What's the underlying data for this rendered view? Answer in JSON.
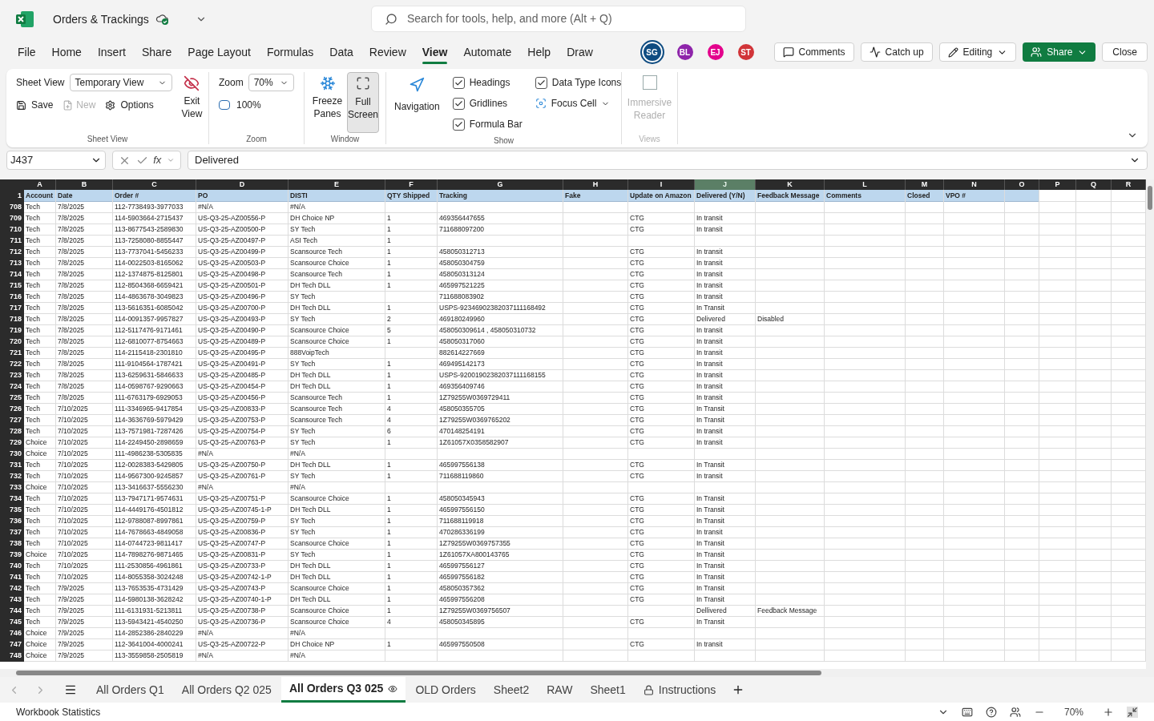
{
  "title_bar": {
    "file_name": "Orders & Trackings",
    "search_placeholder": "Search for tools, help, and more (Alt + Q)"
  },
  "menu_tabs": [
    {
      "label": "File",
      "selected": false
    },
    {
      "label": "Home",
      "selected": false
    },
    {
      "label": "Insert",
      "selected": false
    },
    {
      "label": "Share",
      "selected": false
    },
    {
      "label": "Page Layout",
      "selected": false
    },
    {
      "label": "Formulas",
      "selected": false
    },
    {
      "label": "Data",
      "selected": false
    },
    {
      "label": "Review",
      "selected": false
    },
    {
      "label": "View",
      "selected": true
    },
    {
      "label": "Automate",
      "selected": false
    },
    {
      "label": "Help",
      "selected": false
    },
    {
      "label": "Draw",
      "selected": false
    }
  ],
  "collaborators": [
    {
      "initials": "SG",
      "color": "#0f4c81"
    },
    {
      "initials": "BL",
      "color": "#8e24aa"
    },
    {
      "initials": "EJ",
      "color": "#e3008c"
    },
    {
      "initials": "ST",
      "color": "#d13438"
    }
  ],
  "header_buttons": {
    "comments": "Comments",
    "catch_up": "Catch up",
    "editing": "Editing",
    "share": "Share",
    "close": "Close"
  },
  "ribbon": {
    "sheet_view": {
      "label": "Sheet View",
      "dropdown": "Temporary View",
      "save": "Save",
      "new": "New",
      "new_disabled": true,
      "options": "Options",
      "exit": "Exit View",
      "group": "Sheet View"
    },
    "zoom": {
      "label": "Zoom",
      "value": "70%",
      "reset": "100%",
      "group": "Zoom"
    },
    "window": {
      "freeze": "Freeze Panes",
      "full_screen": "Full Screen",
      "full_screen_selected": true,
      "group": "Window"
    },
    "show": {
      "navigation": "Navigation",
      "checkboxes": [
        {
          "label": "Headings",
          "checked": true
        },
        {
          "label": "Gridlines",
          "checked": true
        },
        {
          "label": "Formula Bar",
          "checked": true
        },
        {
          "label": "Data Type Icons",
          "checked": true
        }
      ],
      "focus_cell": "Focus Cell",
      "group": "Show"
    },
    "views": {
      "reader": "Immersive Reader",
      "disabled": true,
      "group": "Views"
    }
  },
  "formula_bar": {
    "name_box": "J437",
    "fx": "fx",
    "value": "Delivered"
  },
  "columns": [
    {
      "letter": "A",
      "selected": false
    },
    {
      "letter": "B",
      "selected": false
    },
    {
      "letter": "C",
      "selected": false
    },
    {
      "letter": "D",
      "selected": false
    },
    {
      "letter": "E",
      "selected": false
    },
    {
      "letter": "F",
      "selected": false
    },
    {
      "letter": "G",
      "selected": false
    },
    {
      "letter": "H",
      "selected": false
    },
    {
      "letter": "I",
      "selected": false
    },
    {
      "letter": "J",
      "selected": true
    },
    {
      "letter": "K",
      "selected": false
    },
    {
      "letter": "L",
      "selected": false
    },
    {
      "letter": "M",
      "selected": false
    },
    {
      "letter": "N",
      "selected": false
    },
    {
      "letter": "O",
      "selected": false
    },
    {
      "letter": "P",
      "selected": false
    },
    {
      "letter": "Q",
      "selected": false
    },
    {
      "letter": "R",
      "selected": false
    }
  ],
  "header_row": {
    "row": "1",
    "A": "Account",
    "B": "Date",
    "C": "Order #",
    "D": "PO",
    "E": "DISTI",
    "F": "QTY Shipped",
    "G": "Tracking",
    "H": "Fake",
    "I": "Update on Amazon",
    "J": "Delivered (Y/N)",
    "K": "Feedback Message",
    "L": "Comments",
    "M": "Closed",
    "N": "VPO #"
  },
  "rows": [
    {
      "row": "708",
      "A": "Tech",
      "B": "7/8/2025",
      "C": "112-7738493-3977033",
      "D": "#N/A",
      "E": "#N/A"
    },
    {
      "row": "709",
      "A": "Tech",
      "B": "7/8/2025",
      "C": "114-5903664-2715437",
      "D": "US-Q3-25-AZ00556-P",
      "E": "DH Choice NP",
      "F": "1",
      "G": "469356447655",
      "I": "CTG",
      "J": "In transit"
    },
    {
      "row": "710",
      "A": "Tech",
      "B": "7/8/2025",
      "C": "113-8677543-2589830",
      "D": "US-Q3-25-AZ00500-P",
      "E": "SY Tech",
      "F": "1",
      "G": "711688097200",
      "I": "CTG",
      "J": "In transit"
    },
    {
      "row": "711",
      "A": "Tech",
      "B": "7/8/2025",
      "C": "113-7258080-8855447",
      "D": "US-Q3-25-AZ00497-P",
      "E": "ASI Tech",
      "F": "1"
    },
    {
      "row": "712",
      "A": "Tech",
      "B": "7/8/2025",
      "C": "113-7737041-5456233",
      "D": "US-Q3-25-AZ00499-P",
      "E": "Scansource Tech",
      "F": "1",
      "G": "458050312713",
      "I": "CTG",
      "J": "In transit"
    },
    {
      "row": "713",
      "A": "Tech",
      "B": "7/8/2025",
      "C": "114-0022503-8165062",
      "D": "US-Q3-25-AZ00503-P",
      "E": "Scansource Choice",
      "F": "1",
      "G": "458050304759",
      "I": "CTG",
      "J": "In transit"
    },
    {
      "row": "714",
      "A": "Tech",
      "B": "7/8/2025",
      "C": "112-1374875-8125801",
      "D": "US-Q3-25-AZ00498-P",
      "E": "Scansource Tech",
      "F": "1",
      "G": "458050313124",
      "I": "CTG",
      "J": "In transit"
    },
    {
      "row": "715",
      "A": "Tech",
      "B": "7/8/2025",
      "C": "112-8504368-6659421",
      "D": "US-Q3-25-AZ00501-P",
      "E": "DH Tech DLL",
      "F": "1",
      "G": "465997521225",
      "I": "CTG",
      "J": "In transit"
    },
    {
      "row": "716",
      "A": "Tech",
      "B": "7/8/2025",
      "C": "114-4863678-3049823",
      "D": "US-Q3-25-AZ00496-P",
      "E": "SY Tech",
      "G": "711688083902",
      "I": "CTG",
      "J": "In transit"
    },
    {
      "row": "717",
      "A": "Tech",
      "B": "7/8/2025",
      "C": "113-5616351-6085042",
      "D": "US-Q3-25-AZ00700-P",
      "E": "DH Tech DLL",
      "F": "1",
      "G": "USPS-92346902382037111168492",
      "I": "CTG",
      "J": "In Transit"
    },
    {
      "row": "718",
      "A": "Tech",
      "B": "7/8/2025",
      "C": "114-0091357-9957827",
      "D": "US-Q3-25-AZ00493-P",
      "E": "SY Tech",
      "F": "2",
      "G": "469180249960",
      "I": "CTG",
      "J": "Delivered",
      "K": "Disabled"
    },
    {
      "row": "719",
      "A": "Tech",
      "B": "7/8/2025",
      "C": "112-5117476-9171461",
      "D": "US-Q3-25-AZ00490-P",
      "E": "Scansource Choice",
      "F": "5",
      "G": "458050309614 , 458050310732",
      "I": "CTG",
      "J": "In transit"
    },
    {
      "row": "720",
      "A": "Tech",
      "B": "7/8/2025",
      "C": "112-6810077-8754663",
      "D": "US-Q3-25-AZ00489-P",
      "E": "Scansource Choice",
      "F": "1",
      "G": "458050317060",
      "I": "CTG",
      "J": "In transit"
    },
    {
      "row": "721",
      "A": "Tech",
      "B": "7/8/2025",
      "C": "114-2115418-2301810",
      "D": "US-Q3-25-AZ00495-P",
      "E": "888VoipTech",
      "G": "882614227669",
      "I": "CTG",
      "J": "In transit"
    },
    {
      "row": "722",
      "A": "Tech",
      "B": "7/8/2025",
      "C": "111-9104564-1787421",
      "D": "US-Q3-25-AZ00491-P",
      "E": "SY Tech",
      "F": "1",
      "G": "469495142173",
      "I": "CTG",
      "J": "In transit"
    },
    {
      "row": "723",
      "A": "Tech",
      "B": "7/8/2025",
      "C": "113-6259631-5846633",
      "D": "US-Q3-25-AZ00485-P",
      "E": "DH Tech DLL",
      "F": "1",
      "G": "USPS-92001902382037111168155",
      "I": "CTG",
      "J": "In transit"
    },
    {
      "row": "724",
      "A": "Tech",
      "B": "7/8/2025",
      "C": "114-0598767-9290663",
      "D": "US-Q3-25-AZ00454-P",
      "E": "DH Tech DLL",
      "F": "1",
      "G": "469356409746",
      "I": "CTG",
      "J": "In transit"
    },
    {
      "row": "725",
      "A": "Tech",
      "B": "7/8/2025",
      "C": "111-6763179-6929053",
      "D": "US-Q3-25-AZ00456-P",
      "E": "Scansource Tech",
      "F": "1",
      "G": "1Z79255W0369729411",
      "I": "CTG",
      "J": "In transit"
    },
    {
      "row": "726",
      "A": "Tech",
      "B": "7/10/2025",
      "C": "111-3346965-9417854",
      "D": "US-Q3-25-AZ00833-P",
      "E": "Scansource Tech",
      "F": "4",
      "G": "458050355705",
      "I": "CTG",
      "J": "In Transit"
    },
    {
      "row": "727",
      "A": "Tech",
      "B": "7/10/2025",
      "C": "114-3636769-5979429",
      "D": "US-Q3-25-AZ00753-P",
      "E": "Scansource Tech",
      "F": "4",
      "G": "1Z79255W0369765202",
      "I": "CTG",
      "J": "In Transit"
    },
    {
      "row": "728",
      "A": "Tech",
      "B": "7/10/2025",
      "C": "113-7571981-7287426",
      "D": "US-Q3-25-AZ00754-P",
      "E": "SY Tech",
      "F": "6",
      "G": "470148254191",
      "I": "CTG",
      "J": "In transit"
    },
    {
      "row": "729",
      "A": "Choice",
      "B": "7/10/2025",
      "C": "114-2249450-2898659",
      "D": "US-Q3-25-AZ00763-P",
      "E": "SY Tech",
      "F": "1",
      "G": "1Z61057X0358582907",
      "I": "CTG",
      "J": "In transit"
    },
    {
      "row": "730",
      "A": "Choice",
      "B": "7/10/2025",
      "C": "111-4986238-5305835",
      "D": "#N/A",
      "E": "#N/A"
    },
    {
      "row": "731",
      "A": "Tech",
      "B": "7/10/2025",
      "C": "112-0028383-5429805",
      "D": "US-Q3-25-AZ00750-P",
      "E": "DH Tech DLL",
      "F": "1",
      "G": "465997556138",
      "I": "CTG",
      "J": "In Transit"
    },
    {
      "row": "732",
      "A": "Tech",
      "B": "7/10/2025",
      "C": "114-9567300-9245857",
      "D": "US-Q3-25-AZ00761-P",
      "E": "SY Tech",
      "F": "1",
      "G": "711688119860",
      "I": "CTG",
      "J": "In transit"
    },
    {
      "row": "733",
      "A": "Choice",
      "B": "7/10/2025",
      "C": "113-3416637-5556230",
      "D": "#N/A",
      "E": "#N/A"
    },
    {
      "row": "734",
      "A": "Tech",
      "B": "7/10/2025",
      "C": "113-7947171-9574631",
      "D": "US-Q3-25-AZ00751-P",
      "E": "Scansource Choice",
      "F": "1",
      "G": "458050345943",
      "I": "CTG",
      "J": "In Transit"
    },
    {
      "row": "735",
      "A": "Tech",
      "B": "7/10/2025",
      "C": "114-4449176-4501812",
      "D": "US-Q3-25-AZ00745-1-P",
      "E": "DH Tech DLL",
      "F": "1",
      "G": "465997556150",
      "I": "CTG",
      "J": "In Transit"
    },
    {
      "row": "736",
      "A": "Tech",
      "B": "7/10/2025",
      "C": "112-9788087-8997861",
      "D": "US-Q3-25-AZ00759-P",
      "E": "SY Tech",
      "F": "1",
      "G": "711688119918",
      "I": "CTG",
      "J": "In Transit"
    },
    {
      "row": "737",
      "A": "Tech",
      "B": "7/10/2025",
      "C": "114-7678663-4849058",
      "D": "US-Q3-25-AZ00836-P",
      "E": "SY Tech",
      "F": "1",
      "G": "470286336199",
      "I": "CTG",
      "J": "In transit"
    },
    {
      "row": "738",
      "A": "Tech",
      "B": "7/10/2025",
      "C": "114-0744723-9811417",
      "D": "US-Q3-25-AZ00747-P",
      "E": "Scansource Choice",
      "F": "1",
      "G": "1Z79255W0369757355",
      "I": "CTG",
      "J": "In Transit"
    },
    {
      "row": "739",
      "A": "Choice",
      "B": "7/10/2025",
      "C": "114-7898276-9871465",
      "D": "US-Q3-25-AZ00831-P",
      "E": "SY Tech",
      "F": "1",
      "G": "1Z61057XA800143765",
      "I": "CTG",
      "J": "In Transit"
    },
    {
      "row": "740",
      "A": "Tech",
      "B": "7/10/2025",
      "C": "111-2530856-4961861",
      "D": "US-Q3-25-AZ00733-P",
      "E": "DH Tech DLL",
      "F": "1",
      "G": "465997556127",
      "I": "CTG",
      "J": "In Transit"
    },
    {
      "row": "741",
      "A": "Tech",
      "B": "7/10/2025",
      "C": "114-8055358-3024248",
      "D": "US-Q3-25-AZ00742-1-P",
      "E": "DH Tech DLL",
      "F": "1",
      "G": "465997556182",
      "I": "CTG",
      "J": "In Transit"
    },
    {
      "row": "742",
      "A": "Tech",
      "B": "7/9/2025",
      "C": "113-7653535-4731429",
      "D": "US-Q3-25-AZ00743-P",
      "E": "Scansource Choice",
      "F": "1",
      "G": "458050357362",
      "I": "CTG",
      "J": "In Transit"
    },
    {
      "row": "743",
      "A": "Tech",
      "B": "7/9/2025",
      "C": "114-5980138-3628242",
      "D": "US-Q3-25-AZ00740-1-P",
      "E": "DH Tech DLL",
      "F": "1",
      "G": "465997556208",
      "I": "CTG",
      "J": "In Transit"
    },
    {
      "row": "744",
      "A": "Tech",
      "B": "7/9/2025",
      "C": "111-6131931-5213811",
      "D": "US-Q3-25-AZ00738-P",
      "E": "Scansource Choice",
      "F": "1",
      "G": "1Z79255W0369756507",
      "J": "Dellivered",
      "K": "Feedback Message"
    },
    {
      "row": "745",
      "A": "Tech",
      "B": "7/9/2025",
      "C": "113-5943421-4540250",
      "D": "US-Q3-25-AZ00736-P",
      "E": "Scansource Choice",
      "F": "4",
      "G": "458050345895",
      "I": "CTG",
      "J": "In Transit"
    },
    {
      "row": "746",
      "A": "Choice",
      "B": "7/9/2025",
      "C": "114-2852386-2840229",
      "D": "#N/A",
      "E": "#N/A"
    },
    {
      "row": "747",
      "A": "Choice",
      "B": "7/9/2025",
      "C": "112-3641004-4000241",
      "D": "US-Q3-25-AZ00722-P",
      "E": "DH Choice NP",
      "F": "1",
      "G": "465997550508",
      "I": "CTG",
      "J": "In transit"
    },
    {
      "row": "748",
      "A": "Choice",
      "B": "7/9/2025",
      "C": "113-3559858-2505819",
      "D": "#N/A",
      "E": "#N/A"
    }
  ],
  "sheet_tabs": [
    {
      "label": "All Orders Q1",
      "selected": false,
      "kind": "plain"
    },
    {
      "label": "All Orders Q2 025",
      "selected": false,
      "kind": "plain"
    },
    {
      "label": "All Orders Q3 025",
      "selected": true,
      "kind": "sheet_view"
    },
    {
      "label": "OLD Orders",
      "selected": false,
      "kind": "plain"
    },
    {
      "label": "Sheet2",
      "selected": false,
      "kind": "plain"
    },
    {
      "label": "RAW",
      "selected": false,
      "kind": "plain"
    },
    {
      "label": "Sheet1",
      "selected": false,
      "kind": "plain"
    },
    {
      "label": "Instructions",
      "selected": false,
      "kind": "protected"
    }
  ],
  "status_bar": {
    "left": "Workbook Statistics",
    "zoom": "70%"
  }
}
